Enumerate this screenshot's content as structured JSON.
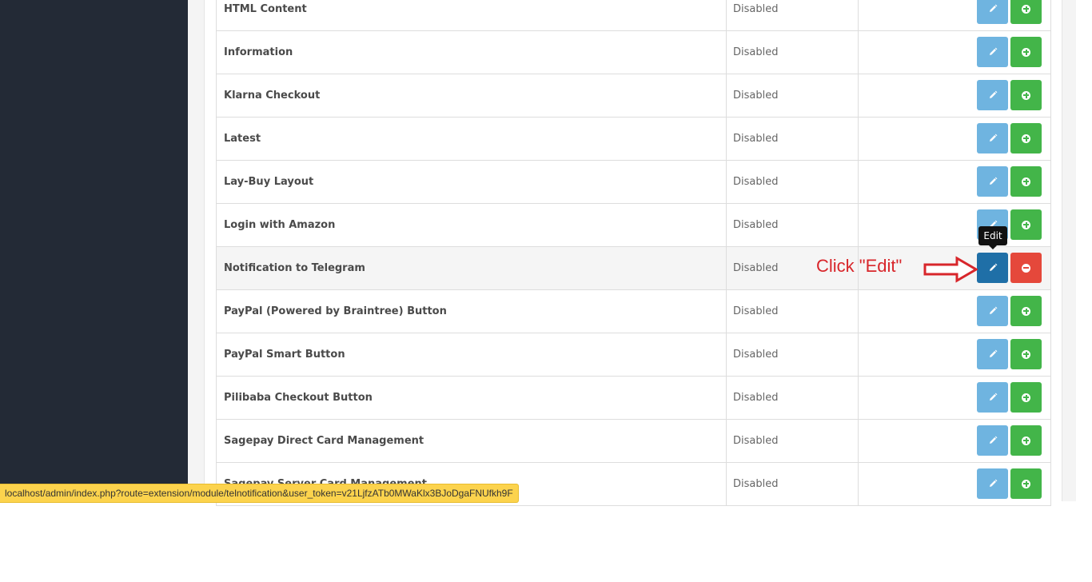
{
  "modules": [
    {
      "name": "HTML Content",
      "status": "Disabled",
      "action": "install"
    },
    {
      "name": "Information",
      "status": "Disabled",
      "action": "install"
    },
    {
      "name": "Klarna Checkout",
      "status": "Disabled",
      "action": "install"
    },
    {
      "name": "Latest",
      "status": "Disabled",
      "action": "install"
    },
    {
      "name": "Lay-Buy Layout",
      "status": "Disabled",
      "action": "install"
    },
    {
      "name": "Login with Amazon",
      "status": "Disabled",
      "action": "install"
    },
    {
      "name": "Notification to Telegram",
      "status": "Disabled",
      "action": "uninstall"
    },
    {
      "name": "PayPal (Powered by Braintree) Button",
      "status": "Disabled",
      "action": "install"
    },
    {
      "name": "PayPal Smart Button",
      "status": "Disabled",
      "action": "install"
    },
    {
      "name": "Pilibaba Checkout Button",
      "status": "Disabled",
      "action": "install"
    },
    {
      "name": "Sagepay Direct Card Management",
      "status": "Disabled",
      "action": "install"
    },
    {
      "name": "Sagepay Server Card Management",
      "status": "Disabled",
      "action": "install"
    }
  ],
  "tooltip": {
    "text": "Edit"
  },
  "annotation": {
    "text": "Click \"Edit\""
  },
  "status_bar": {
    "url": "localhost/admin/index.php?route=extension/module/telnotification&user_token=v21LjfzATb0MWaKlx3BJoDgaFNUfkh9F"
  },
  "icons": {
    "edit": "pencil-icon",
    "install": "plus-circle-icon",
    "uninstall": "minus-circle-icon"
  },
  "colors": {
    "sidebar": "#232a36",
    "edit_button": "#6fb4e0",
    "edit_button_active": "#1f6fa7",
    "install_button": "#43b549",
    "uninstall_button": "#e5483b",
    "annotation": "#d8262b",
    "status_bar": "#fcd34d"
  }
}
